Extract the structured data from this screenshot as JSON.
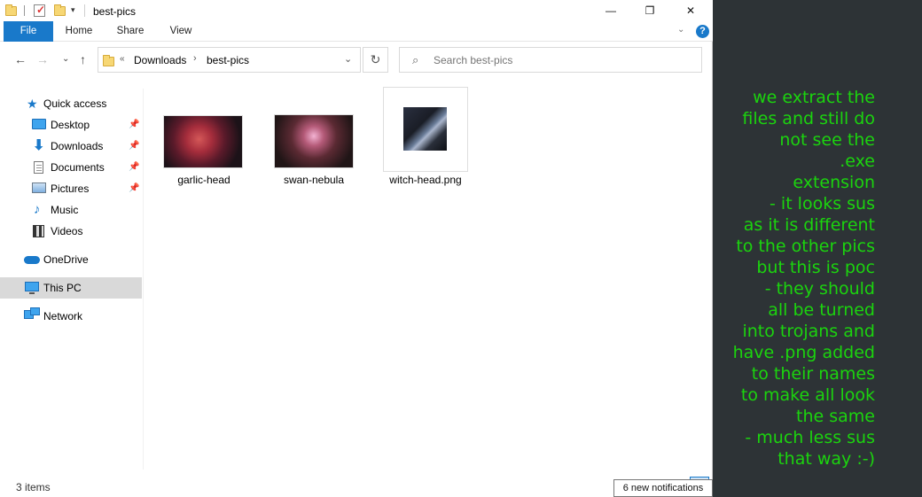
{
  "window": {
    "title": "best-pics",
    "min_glyph": "—",
    "max_glyph": "❐",
    "close_glyph": "✕",
    "qa_dropdown_glyph": "▾"
  },
  "ribbon": {
    "tabs": [
      "File",
      "Home",
      "Share",
      "View"
    ],
    "chevron_glyph": "⌄",
    "help_glyph": "?"
  },
  "nav": {
    "back_glyph": "←",
    "forward_glyph": "→",
    "recent_glyph": "⌄",
    "up_glyph": "↑",
    "address": {
      "chevron": "«",
      "crumbs": [
        "Downloads",
        "best-pics"
      ],
      "sep": "›",
      "dropdown_glyph": "⌄"
    },
    "refresh_glyph": "↻",
    "search": {
      "placeholder": "Search best-pics",
      "icon_glyph": "⌕"
    }
  },
  "sidebar": {
    "pin_glyph": "📌",
    "items": [
      {
        "label": "Quick access",
        "icon": "star-icon",
        "glyph": "★"
      },
      {
        "label": "Desktop",
        "icon": "desktop-icon",
        "pinned": true
      },
      {
        "label": "Downloads",
        "icon": "download-icon",
        "glyph": "⬇",
        "pinned": true
      },
      {
        "label": "Documents",
        "icon": "document-icon",
        "pinned": true
      },
      {
        "label": "Pictures",
        "icon": "pictures-icon",
        "pinned": true
      },
      {
        "label": "Music",
        "icon": "music-icon",
        "glyph": "♪"
      },
      {
        "label": "Videos",
        "icon": "video-icon"
      },
      {
        "label": "OneDrive",
        "icon": "cloud-icon"
      },
      {
        "label": "This PC",
        "icon": "computer-icon",
        "selected": true
      },
      {
        "label": "Network",
        "icon": "network-icon"
      }
    ]
  },
  "files": [
    {
      "name": "garlic-head"
    },
    {
      "name": "swan-nebula"
    },
    {
      "name": "witch-head.png"
    }
  ],
  "status": {
    "count": "3 items",
    "notifications": "6 new notifications"
  },
  "note": {
    "lines": [
      "we extract the",
      "files and still do",
      "not see the",
      ".exe",
      "extension",
      "- it looks sus",
      "as it is different",
      "to the other pics",
      "but this is poc",
      "- they should",
      "all be turned",
      "into trojans and",
      "have .png added",
      "to their names",
      "to make all look",
      "the same",
      "- much less sus",
      "that way :-)"
    ],
    "color": "#1bd40e"
  }
}
